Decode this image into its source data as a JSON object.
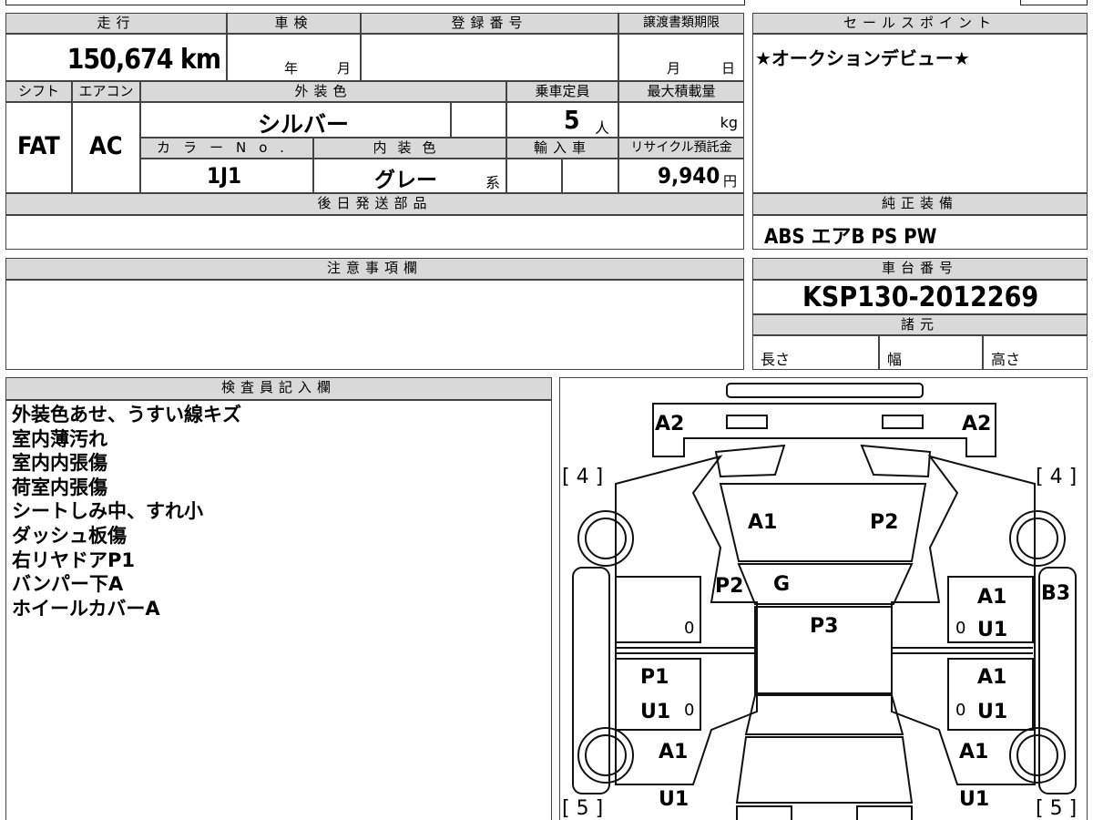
{
  "header": {
    "mileage_label": "走行",
    "shaken_label": "車検",
    "reg_label": "登録番号",
    "transfer_label": "譲渡書類期限",
    "sales_label": "セールスポイント",
    "mileage_value": "150,674 km",
    "shaken_year": "年",
    "shaken_month": "月",
    "transfer_month": "月",
    "transfer_day": "日"
  },
  "specs": {
    "shift_label": "シフト",
    "ac_label": "エアコン",
    "exterior_label": "外装色",
    "capacity_label": "乗車定員",
    "maxload_label": "最大積載量",
    "shift_value": "FAT",
    "ac_value": "AC",
    "exterior_value": "シルバー",
    "capacity_value": "5",
    "capacity_unit": "人",
    "maxload_unit": "kg",
    "color_no_label": "カラーNo.",
    "interior_label": "内装色",
    "import_label": "輸入車",
    "recycle_label": "リサイクル預託金",
    "color_no_value": "1J1",
    "interior_value": "グレー",
    "interior_suffix": "系",
    "recycle_value": "9,940",
    "recycle_unit": "円"
  },
  "sales_point": {
    "text": "★オークションデビュー★"
  },
  "later_parts": {
    "label": "後日発送部品"
  },
  "equipment": {
    "label": "純正装備",
    "value": "ABS エアB PS PW"
  },
  "caution": {
    "label": "注意事項欄"
  },
  "chassis": {
    "label": "車台番号",
    "value": "KSP130-2012269",
    "dims_label": "諸元",
    "length_label": "長さ",
    "width_label": "幅",
    "height_label": "高さ"
  },
  "inspector": {
    "label": "検査員記入欄",
    "lines": [
      "外装色あせ、うすい線キズ",
      "室内薄汚れ",
      "室内内張傷",
      "荷室内張傷",
      "シートしみ中、すれ小",
      "ダッシュ板傷",
      "右リヤドアP1",
      "バンパー下A",
      "ホイールカバーA"
    ]
  },
  "diagram": {
    "marks": {
      "a2_left": "A2",
      "a2_right": "A2",
      "tire_fl": "[ 4 ]",
      "tire_fr": "[ 4 ]",
      "a1_hood": "A1",
      "p2_hood": "P2",
      "p2_side": "P2",
      "g_glass": "G",
      "p3_roof": "P3",
      "a1_rf": "A1",
      "u1_rf": "U1",
      "b3_right": "B3",
      "p1_lr": "P1",
      "u1_lr": "U1",
      "a1_rr": "A1",
      "u1_rr": "U1",
      "a1_lq": "A1",
      "u1_lq": "U1",
      "a1_rq": "A1",
      "u1_rq": "U1",
      "tire_rl": "[ 5 ]",
      "tire_rr": "[ 5 ]",
      "zero_1": "0",
      "zero_2": "0",
      "zero_3": "0",
      "zero_4": "0"
    }
  }
}
